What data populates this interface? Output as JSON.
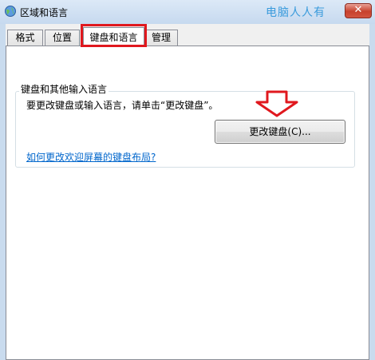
{
  "window": {
    "title": "区域和语言",
    "watermark": "电脑人人有",
    "close_label": "✕"
  },
  "tabs": [
    {
      "label": "格式",
      "active": false
    },
    {
      "label": "位置",
      "active": false
    },
    {
      "label": "键盘和语言",
      "active": true
    },
    {
      "label": "管理",
      "active": false
    }
  ],
  "keyboard_group": {
    "title": "键盘和其他输入语言",
    "description": "要更改键盘或输入语言，请单击“更改键盘”。",
    "change_button_label": "更改键盘(C)...",
    "help_link": "如何更改欢迎屏幕的键盘布局?"
  },
  "colors": {
    "highlight": "#e0181e",
    "link": "#0066cc",
    "watermark": "#3a9bdc"
  }
}
